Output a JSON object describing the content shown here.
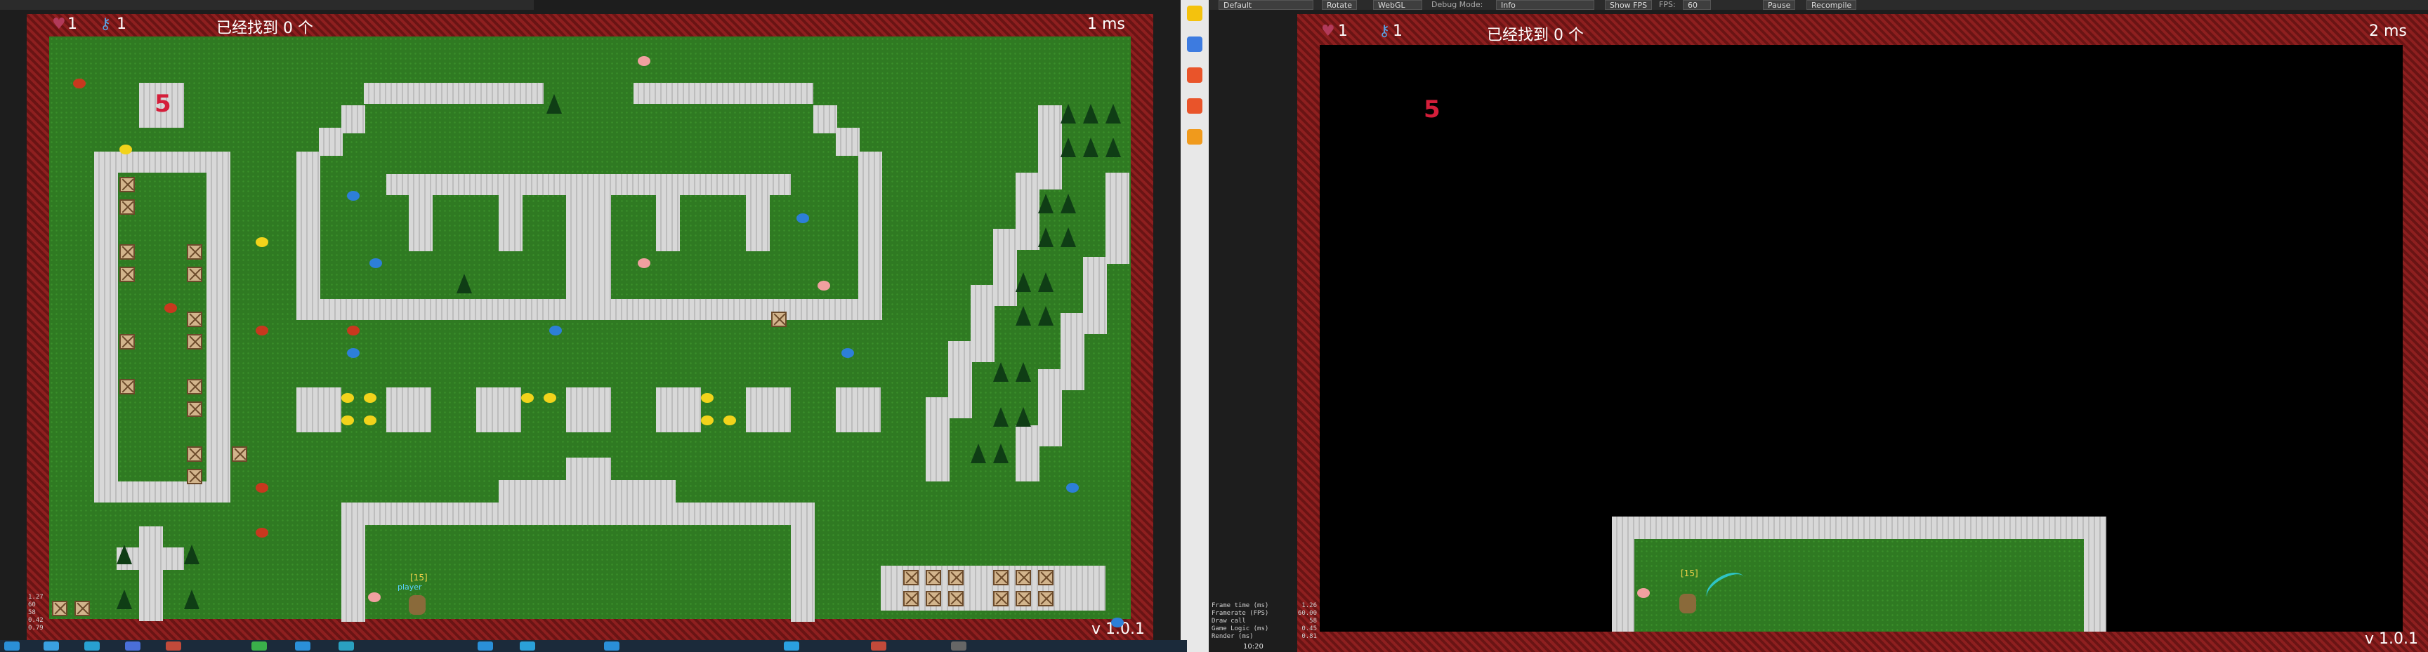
{
  "left_view": {
    "hud": {
      "lives": "1",
      "keys": "1",
      "found_text": "已经找到 0 个",
      "frame_time": "1 ms",
      "version": "v 1.0.1"
    },
    "room_number": "5",
    "player": {
      "level_tag": "[15]",
      "name_tag": "player"
    }
  },
  "right_view": {
    "hud": {
      "lives": "1",
      "keys": "1",
      "found_text": "已经找到 0 个",
      "frame_time": "2 ms",
      "version": "v 1.0.1"
    },
    "room_number": "5",
    "player": {
      "level_tag": "[15]"
    }
  },
  "editor_toolbar": {
    "layout_select": "Default",
    "rotate_button": "Rotate",
    "renderer_select": "WebGL",
    "debug_label": "Debug Mode:",
    "debug_select": "Info",
    "show_fps_button": "Show FPS",
    "fps_label": "FPS:",
    "fps_value": "60",
    "pause_button": "Pause",
    "recompile_button": "Recompile"
  },
  "perf_stats_right": {
    "labels": [
      "Frame time (ms)",
      "Framerate (FPS)",
      "Draw call",
      "Game Logic (ms)",
      "Render (ms)"
    ],
    "values": [
      "1.26",
      "60.00",
      "58",
      "0.45",
      "0.81"
    ]
  },
  "perf_stats_left": {
    "values": [
      "1.27",
      "60",
      "58",
      "0.42",
      "0.79"
    ]
  },
  "clock": "10:20",
  "colors": {
    "border": "#7a1a1a",
    "grass": "#2f7a22",
    "wall": "#cfcfcf",
    "accent_number": "#d41e3a"
  }
}
